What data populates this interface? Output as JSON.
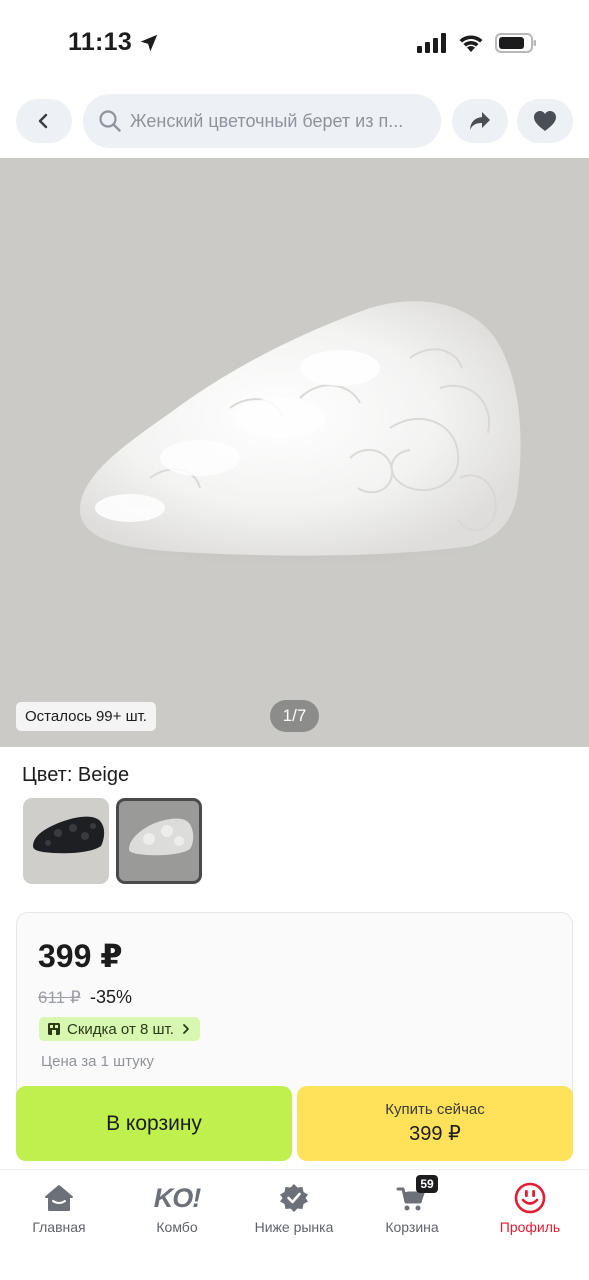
{
  "status_bar": {
    "time": "11:13"
  },
  "top_nav": {
    "search_text": "Женский цветочный берет из п..."
  },
  "gallery": {
    "stock_badge": "Осталось 99+ шт.",
    "counter": "1/7"
  },
  "color_selector": {
    "label": "Цвет: Beige",
    "options": [
      "black",
      "beige"
    ],
    "selected": "beige"
  },
  "price_card": {
    "price": "399 ₽",
    "old_price": "611 ₽",
    "discount": "-35%",
    "bulk_discount": "Скидка от 8 шт.",
    "note": "Цена за 1 штуку"
  },
  "actions": {
    "cart_label": "В корзину",
    "buy_label": "Купить сейчас",
    "buy_price": "399 ₽"
  },
  "tab_bar": {
    "home": "Главная",
    "combo": "Комбо",
    "combo_logo": "KO!",
    "below_market": "Ниже рынка",
    "cart": "Корзина",
    "cart_count": "59",
    "profile": "Профиль",
    "active_tab": "profile"
  },
  "colors": {
    "accent_red": "#e41c32",
    "cart_green": "#c0f04e",
    "buy_yellow": "#ffe15a"
  }
}
